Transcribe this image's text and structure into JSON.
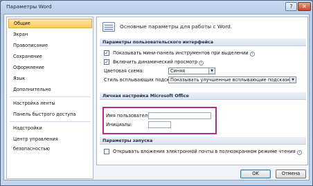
{
  "window": {
    "title": "Параметры Word",
    "help_glyph": "?",
    "close_glyph": "✕"
  },
  "sidebar": {
    "items": [
      {
        "label": "Общие",
        "selected": true
      },
      {
        "label": "Экран"
      },
      {
        "label": "Правописание"
      },
      {
        "label": "Сохранение"
      },
      {
        "label": "Оформление"
      },
      {
        "label": "Язык"
      },
      {
        "label": "Дополнительно"
      },
      {
        "label": "Настройка ленты"
      },
      {
        "label": "Панель быстрого доступа"
      },
      {
        "label": "Надстройки"
      },
      {
        "label": "Центр управления безопасностью"
      }
    ]
  },
  "content": {
    "header_text": "Основные параметры для работы с Word.",
    "sections": {
      "ui": {
        "title": "Параметры пользовательского интерфейса",
        "mini_toolbar": {
          "label": "Показывать мини-панель инструментов при выделении",
          "checked": true,
          "check_glyph": "✓"
        },
        "live_preview": {
          "label": "Включить динамический просмотр",
          "checked": true,
          "check_glyph": "✓"
        },
        "color_scheme": {
          "label": "Цветовая схема:",
          "value": "Синяя"
        },
        "tooltip_style": {
          "label": "Стиль всплывающих подсказок:",
          "value": "Показывать улучшенные всплывающие подсказки"
        }
      },
      "personal": {
        "title": "Личная настройка Microsoft Office",
        "user_name": {
          "label": "Имя пользователя:",
          "value": ""
        },
        "initials": {
          "label": "Инициалы:",
          "value": ""
        }
      },
      "startup": {
        "title": "Параметры запуска",
        "open_attachments": {
          "label": "Открывать вложения электронной почты в полноэкранном режиме чтения",
          "checked": false
        }
      }
    },
    "info_glyph": "i",
    "dropdown_glyph": "▼"
  },
  "footer": {
    "ok_label": "OK",
    "cancel_label": "Отмена"
  },
  "colors": {
    "selection_fill": "#ffcc5a",
    "highlight_border": "#b52a8c"
  }
}
